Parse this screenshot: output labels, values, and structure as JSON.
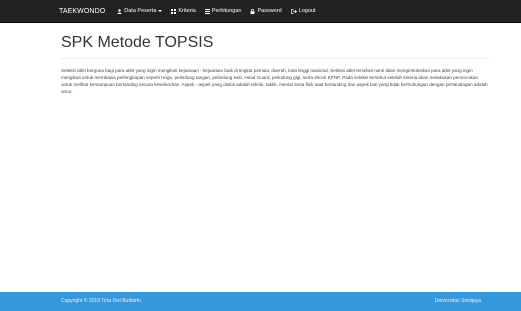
{
  "navbar": {
    "brand": "TAEKWONDO",
    "items": [
      {
        "label": "Data Peserta",
        "icon": "user-icon",
        "dropdown": true
      },
      {
        "label": "Kriteria",
        "icon": "grid-icon",
        "dropdown": false
      },
      {
        "label": "Perhitungan",
        "icon": "list-icon",
        "dropdown": false
      },
      {
        "label": "Password",
        "icon": "lock-icon",
        "dropdown": false
      },
      {
        "label": "Logout",
        "icon": "logout-icon",
        "dropdown": false
      }
    ]
  },
  "main": {
    "title": "SPK Metode TOPSIS",
    "description": "Seleksi atlet berguna bagi para atlet yang ingin mengikuti kejuaraan - kejuaraan baik di tingkat pemula, daerah, kota tinggi nasional. Seleksi atlet tersebut nanti akan mengintruksikan para atlet yang ingin mengikuti untuk membawa perlengkapan seperti Hogu, pelindung tangan, pelindung kaki, Head Guard, pelindung gigi, serta shock KPNP. Pada seleksi tersebut setelah kriteria akan melakukan pencocokan untuk melihat kemampuan bertanding secara keseluruhan. Aspek - aspek yang dinilai adalah teknik, taktik, mental serta fisik saat bertanding dan aspek lain yang tidak berhubungan dengan pertandingan adalah umur."
  },
  "footer": {
    "copyright": "Copyright © 2019 Tirta Dwi Budiarto",
    "university": "Universitas Sriwijaya"
  },
  "colors": {
    "navbar_bg": "#222222",
    "footer_bg": "#3498db"
  }
}
